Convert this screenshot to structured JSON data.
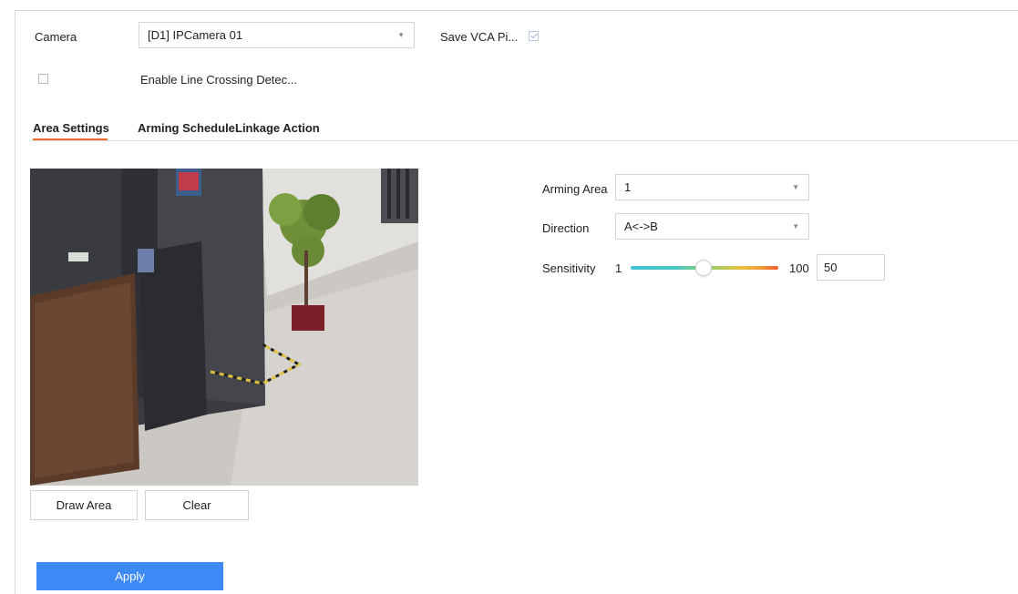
{
  "camera": {
    "label": "Camera",
    "selected": "[D1] IPCamera 01",
    "save_vca_label": "Save VCA Pi...",
    "save_vca_checked": true
  },
  "enable": {
    "label": "Enable Line Crossing Detec...",
    "checked": false
  },
  "tabs": [
    {
      "label": "Area Settings",
      "active": true
    },
    {
      "label": "Arming Schedule",
      "active": false
    },
    {
      "label": "Linkage Action",
      "active": false
    }
  ],
  "video_buttons": {
    "draw_area": "Draw Area",
    "clear": "Clear"
  },
  "settings": {
    "arming_area_label": "Arming Area",
    "arming_area_value": "1",
    "direction_label": "Direction",
    "direction_value": "A<->B",
    "sensitivity_label": "Sensitivity",
    "sensitivity_min": "1",
    "sensitivity_max": "100",
    "sensitivity_value": "50"
  },
  "apply_label": "Apply",
  "colors": {
    "accent": "#3d8af7",
    "tab_underline": "#ee6a2b"
  },
  "icons": {
    "dropdown": "chevron-down-icon",
    "checkbox": "checkbox-icon"
  }
}
